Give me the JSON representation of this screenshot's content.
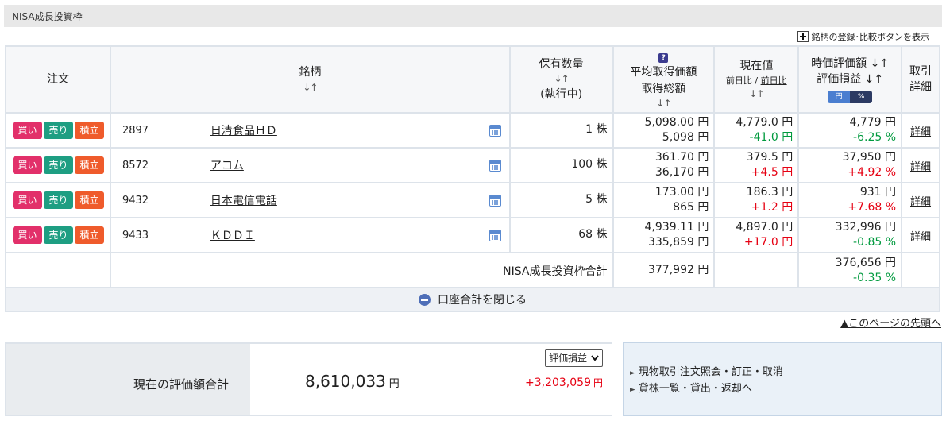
{
  "section_title": "NISA成長投資枠",
  "register_link": "銘柄の登録･比較ボタンを表示",
  "columns": {
    "order": "注文",
    "stock": "銘柄",
    "stock_sort": "↓↑",
    "qty": "保有数量",
    "qty_sort": "↓↑",
    "qty_sub": "(執行中)",
    "help_icon": "?",
    "avg_price": "平均取得価額",
    "total_cost": "取得総額",
    "avg_sort": "↓↑",
    "price": "現在値",
    "price_sub_prefix": "前日比 / ",
    "price_sub_link": "前日比",
    "price_sort": "↓↑",
    "market_value": "時価評価額 ↓↑",
    "pl": "評価損益 ↓↑",
    "toggle_yen": "円",
    "toggle_pct": "%",
    "detail_1": "取引",
    "detail_2": "詳細"
  },
  "buttons": {
    "buy": "買い",
    "sell": "売り",
    "tsumitate": "積立",
    "detail": "詳細"
  },
  "holdings": [
    {
      "code": "2897",
      "name": "日清食品ＨＤ",
      "qty": "1 株",
      "avg_price": "5,098.00 円",
      "total_cost": "5,098 円",
      "price": "4,779.0 円",
      "change": "-41.0 円",
      "market_value": "4,779 円",
      "pl": "-6.25 %"
    },
    {
      "code": "8572",
      "name": "アコム",
      "qty": "100 株",
      "avg_price": "361.70 円",
      "total_cost": "36,170 円",
      "price": "379.5 円",
      "change": "+4.5 円",
      "market_value": "37,950 円",
      "pl": "+4.92 %"
    },
    {
      "code": "9432",
      "name": "日本電信電話",
      "qty": "5 株",
      "avg_price": "173.00 円",
      "total_cost": "865 円",
      "price": "186.3 円",
      "change": "+1.2 円",
      "market_value": "931 円",
      "pl": "+7.68 %"
    },
    {
      "code": "9433",
      "name": "ＫＤＤＩ",
      "qty": "68 株",
      "avg_price": "4,939.11 円",
      "total_cost": "335,859 円",
      "price": "4,897.0 円",
      "change": "+17.0 円",
      "market_value": "332,996 円",
      "pl": "-0.85 %"
    }
  ],
  "total": {
    "label": "NISA成長投資枠合計",
    "cost": "377,992 円",
    "market_value": "376,656 円",
    "pl": "-0.35 %"
  },
  "close_label": "口座合計を閉じる",
  "page_top_link": "▲このページの先頭へ",
  "summary": {
    "label": "現在の評価額合計",
    "value": "8,610,033",
    "unit": "円",
    "select_value": "評価損益",
    "pl": "+3,203,059",
    "pl_unit": "円"
  },
  "links": [
    "現物取引注文照会・訂正・取消",
    "貸株一覧・貸出・返却へ"
  ],
  "colors": {
    "buy": "#e2306a",
    "sell": "#1e9e82",
    "tsumitate": "#ef5b2b",
    "positive": "#e60012",
    "negative": "#009a3e"
  }
}
